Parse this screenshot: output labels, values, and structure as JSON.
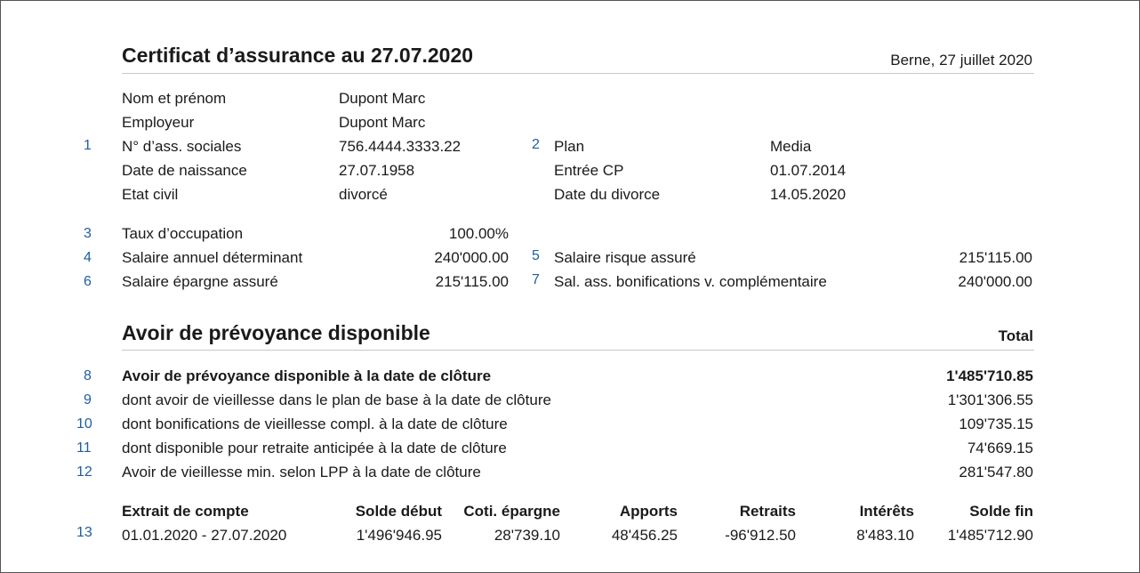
{
  "header": {
    "title": "Certificat d’assurance au 27.07.2020",
    "place_date": "Berne, 27 juillet 2020"
  },
  "person": [
    {
      "label": "Nom et prénom",
      "value": "Dupont Marc"
    },
    {
      "label": "Employeur",
      "value": "Dupont Marc"
    },
    {
      "label": "N° d’ass. sociales",
      "value": "756.4444.3333.22",
      "marker": "1"
    },
    {
      "label": "Date de naissance",
      "value": "27.07.1958"
    },
    {
      "label": "Etat civil",
      "value": "divorcé"
    }
  ],
  "plan": [
    {
      "label": "Plan",
      "value": "Media",
      "marker": "2"
    },
    {
      "label": "Entrée CP",
      "value": "01.07.2014"
    },
    {
      "label": "Date du divorce",
      "value": "14.05.2020"
    }
  ],
  "salary_left": [
    {
      "marker": "3",
      "label": "Taux d’occupation",
      "value": "100.00%"
    },
    {
      "marker": "4",
      "label": "Salaire annuel déterminant",
      "value": "240'000.00"
    },
    {
      "marker": "6",
      "label": "Salaire épargne assuré",
      "value": "215'115.00"
    }
  ],
  "salary_right": [
    {
      "marker": "5",
      "label": "Salaire risque assuré",
      "value": "215'115.00"
    },
    {
      "marker": "7",
      "label": "Sal. ass. bonifications v. complémentaire",
      "value": "240'000.00"
    }
  ],
  "avoir": {
    "title": "Avoir de prévoyance disponible",
    "total_label": "Total",
    "rows": [
      {
        "marker": "8",
        "label": "Avoir de prévoyance disponible à la date de clôture",
        "value": "1'485'710.85",
        "bold": true
      },
      {
        "marker": "9",
        "label": "dont avoir de vieillesse dans le plan de base à la date de clôture",
        "value": "1'301'306.55"
      },
      {
        "marker": "10",
        "label": "dont bonifications de vieillesse compl. à la date de clôture",
        "value": "109'735.15"
      },
      {
        "marker": "11",
        "label": "dont disponible pour retraite anticipée à la date de clôture",
        "value": "74'669.15"
      },
      {
        "marker": "12",
        "label": "Avoir de vieillesse min. selon LPP à la date de clôture",
        "value": "281'547.80"
      }
    ]
  },
  "extrait": {
    "marker": "13",
    "headers": [
      "Extrait de compte",
      "Solde début",
      "Coti. épargne",
      "Apports",
      "Retraits",
      "Intérêts",
      "Solde fin"
    ],
    "row": [
      "01.01.2020 - 27.07.2020",
      "1'496'946.95",
      "28'739.10",
      "48'456.25",
      "-96'912.50",
      "8'483.10",
      "1'485'712.90"
    ]
  }
}
